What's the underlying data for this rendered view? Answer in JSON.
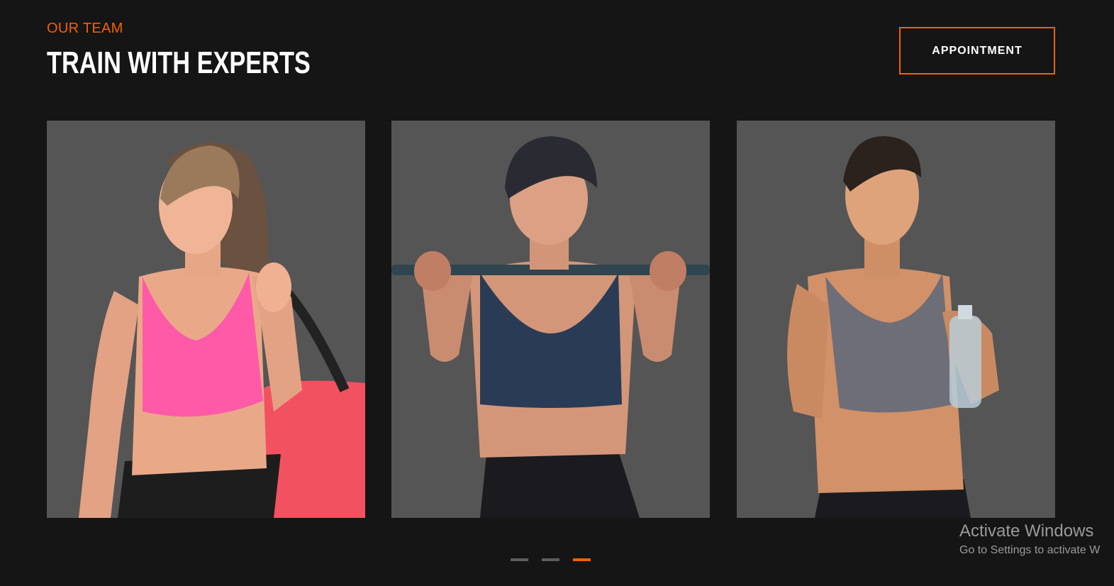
{
  "section": {
    "eyebrow": "OUR TEAM",
    "title": "TRAIN WITH EXPERTS",
    "cta_label": "APPOINTMENT"
  },
  "colors": {
    "accent": "#f36100",
    "background": "#151515",
    "card_background": "#555555",
    "dot_inactive": "#5d5d5d"
  },
  "trainers": [
    {
      "description": "trainer-pink-top-with-gym-bag"
    },
    {
      "description": "trainer-with-barbell"
    },
    {
      "description": "trainer-with-water-bottle"
    }
  ],
  "carousel": {
    "page_count": 3,
    "active_index": 2
  },
  "watermark": {
    "title": "Activate Windows",
    "subtitle": "Go to Settings to activate W"
  }
}
